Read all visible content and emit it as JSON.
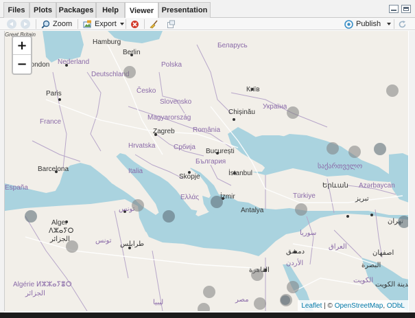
{
  "tabs": [
    {
      "label": "Files",
      "active": false
    },
    {
      "label": "Plots",
      "active": false
    },
    {
      "label": "Packages",
      "active": false
    },
    {
      "label": "Help",
      "active": false
    },
    {
      "label": "Viewer",
      "active": true
    },
    {
      "label": "Presentation",
      "active": false
    }
  ],
  "toolbar": {
    "zoom_label": "Zoom",
    "export_label": "Export",
    "publish_label": "Publish"
  },
  "map": {
    "zoom_in": "+",
    "zoom_out": "−",
    "attribution": {
      "leaflet": "Leaflet",
      "sep": " | © ",
      "osm": "OpenStreetMap",
      "comma": ", ",
      "odbl": "ODbL"
    },
    "labels": [
      "Great Britain",
      "Hamburg",
      "Berlin",
      "Беларусь",
      "London",
      "Nederland",
      "Deutschland",
      "Polska",
      "Paris",
      "Česko",
      "Київ",
      "Slovensko",
      "Україна",
      "France",
      "Magyarország",
      "Chișinău",
      "Zagreb",
      "România",
      "Hrvatska",
      "Србија",
      "București",
      "България",
      "Barcelona",
      "Italia",
      "Skopje",
      "İstanbul",
      "საქართველო",
      "España",
      "Ελλάς",
      "İzmir",
      "Türkiye",
      "Երևան",
      "Azərbaycan",
      "تونس",
      "Antalya",
      "تبریز",
      "Alger",
      "ⴷⵣⴰⵢⵔ",
      "الجزائر",
      "تونس",
      "سوريا",
      "تهران",
      "طرابلس",
      "دمشق",
      "العراق",
      "الأردن",
      "اصفهان",
      "القاهرة",
      "البصرة",
      "Algérie ⵍⵣⵣⴰⵢⴻⵔ",
      "الكويت",
      "الجزائر",
      "مصر",
      "ليبيا",
      "مدينة الكويت"
    ]
  },
  "colors": {
    "water": "#aad3df",
    "land": "#f2efe9",
    "border": "#b7a6c9",
    "marker": "#7f7f7f",
    "marker_dark": "#5f6f7a",
    "link": "#0078a8"
  },
  "icons": {
    "back": "arrow-left-icon",
    "forward": "arrow-right-icon",
    "zoom": "magnifier-icon",
    "export": "export-image-icon",
    "clear": "stop-icon",
    "broom": "broom-icon",
    "popout": "window-popout-icon",
    "publish": "publish-icon",
    "refresh": "refresh-icon"
  }
}
